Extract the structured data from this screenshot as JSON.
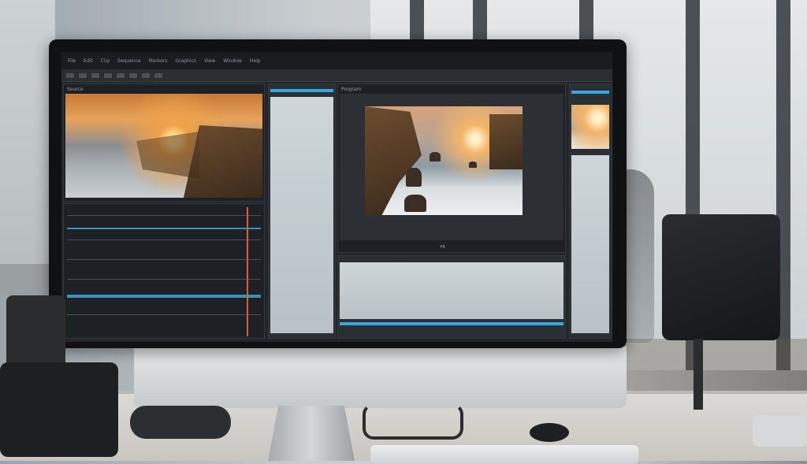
{
  "app": {
    "menu": [
      "File",
      "Edit",
      "Clip",
      "Sequence",
      "Markers",
      "Graphics",
      "View",
      "Window",
      "Help"
    ]
  },
  "panels": {
    "source_tab": "Source",
    "program_tab": "Program",
    "program_caption": "Fit"
  },
  "colors": {
    "accent_blue": "#3aa6e0",
    "playhead": "#d7602e",
    "panel_bg": "#1d2024"
  }
}
